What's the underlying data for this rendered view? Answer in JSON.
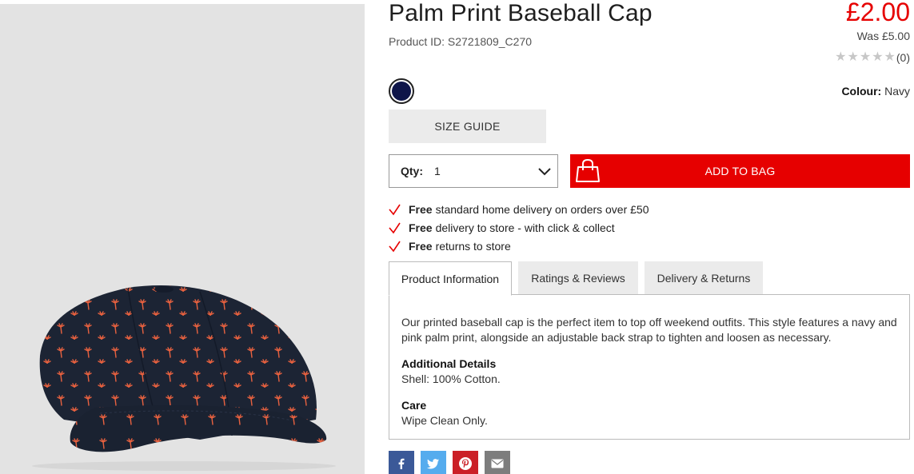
{
  "product": {
    "title": "Palm Print Baseball Cap",
    "product_id": "Product ID: S2721809_C270",
    "price": "£2.00",
    "was_price": "Was £5.00",
    "rating_count": "(0)",
    "stars": 5,
    "colour_label": "Colour:",
    "colour_value": "Navy",
    "swatch_color": "#0e1549"
  },
  "actions": {
    "size_guide": "SIZE GUIDE",
    "qty_label": "Qty:",
    "qty_value": "1",
    "add_to_bag": "ADD TO BAG"
  },
  "perks": [
    {
      "bold": "Free",
      "text": "standard home delivery on orders over £50"
    },
    {
      "bold": "Free",
      "text": "delivery to store - with click & collect"
    },
    {
      "bold": "Free",
      "text": "returns to store"
    }
  ],
  "tabs": [
    {
      "label": "Product Information",
      "active": true
    },
    {
      "label": "Ratings & Reviews",
      "active": false
    },
    {
      "label": "Delivery & Returns",
      "active": false
    }
  ],
  "product_info": {
    "description": "Our printed baseball cap is the perfect item to top off weekend outfits. This style features a navy and pink palm print, alongside an adjustable back strap to tighten and loosen as necessary.",
    "additional_heading": "Additional Details",
    "additional_text": "Shell: 100% Cotton.",
    "care_heading": "Care",
    "care_text": "Wipe Clean Only."
  },
  "share": [
    {
      "icon": "facebook-icon",
      "color": "#3b5998"
    },
    {
      "icon": "twitter-icon",
      "color": "#55acee"
    },
    {
      "icon": "pinterest-icon",
      "color": "#cb2027"
    },
    {
      "icon": "email-icon",
      "color": "#7d7d7d"
    }
  ],
  "colors": {
    "accent": "#e60000",
    "tab_inactive": "#ebebeb",
    "cap_navy": "#1c2434",
    "palm_print": "#e8613f"
  }
}
